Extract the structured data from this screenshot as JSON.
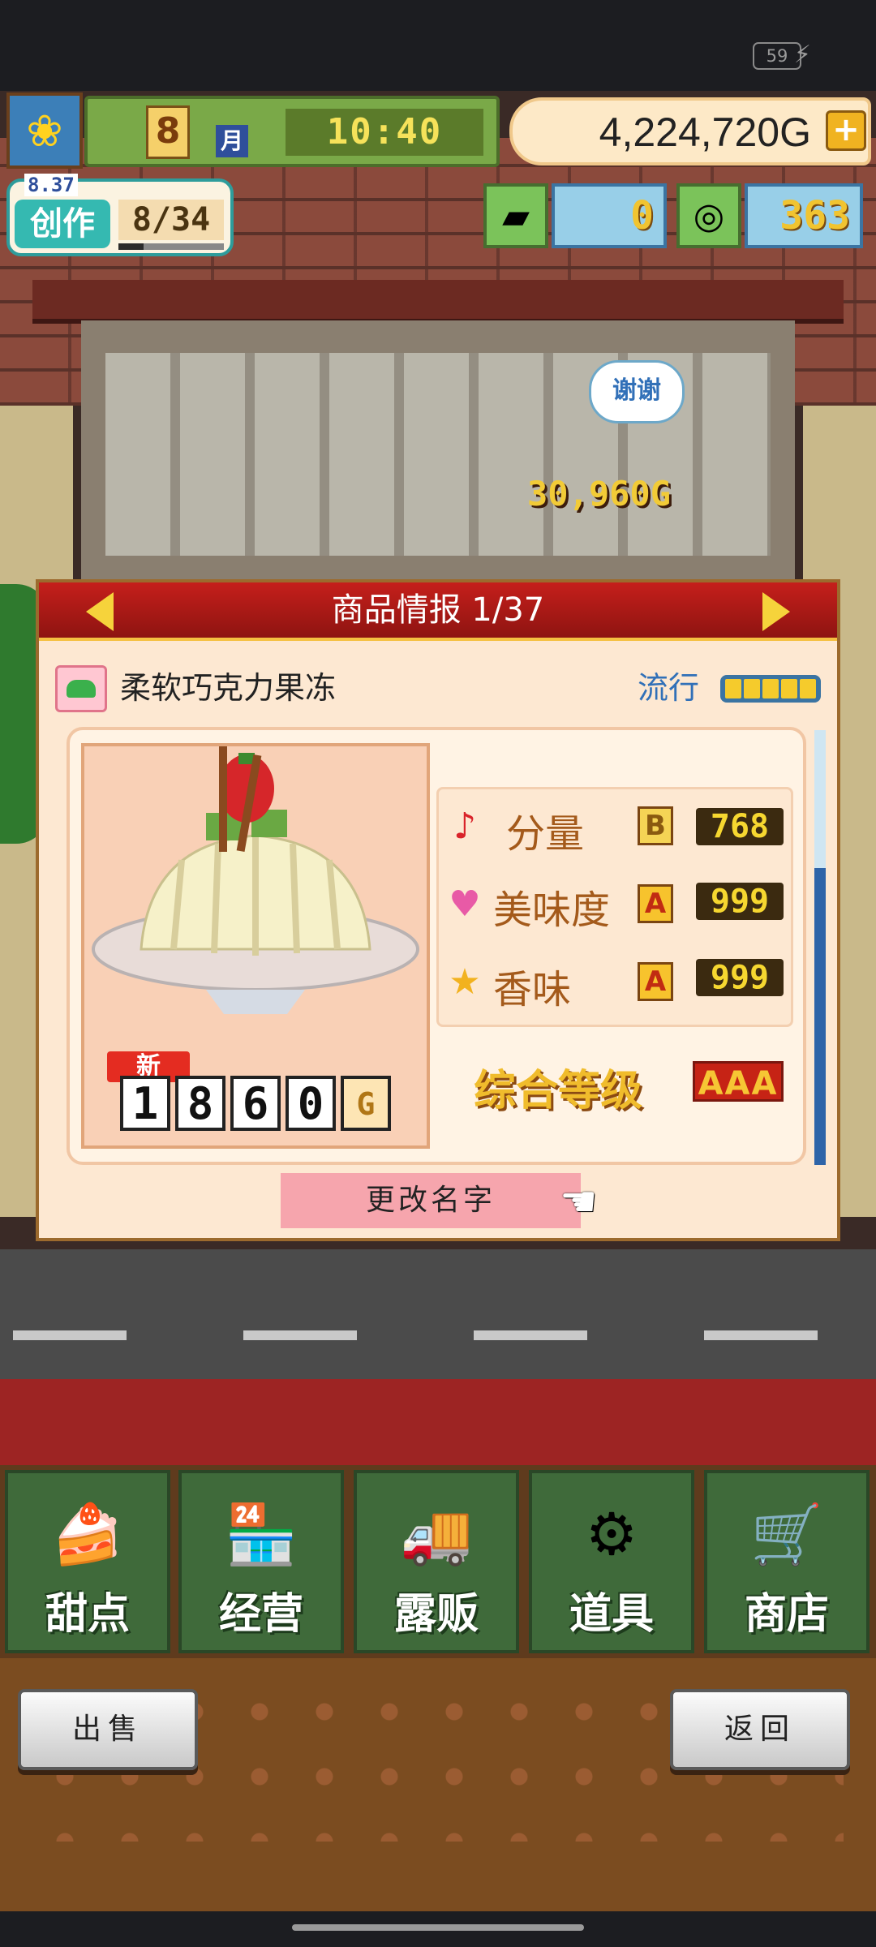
{
  "status_bar": {
    "battery": "59"
  },
  "hud": {
    "month": "8",
    "month_label": "月",
    "time": "10:40",
    "gold": "4,224,720G",
    "create_date": "8.37",
    "create_label": "创作",
    "create_progress": "8/34",
    "create_progress_ratio": 0.24,
    "ticket_count": "0",
    "medal_count": "363"
  },
  "scene": {
    "speech_bubble": "谢谢",
    "earned_popup": "30,960G"
  },
  "dialog": {
    "title": "商品情报 1/37",
    "product_name": "柔软巧克力果冻",
    "trend_label": "流行",
    "trend_level": 5,
    "trend_max": 5,
    "new_badge": "新",
    "price_digits": [
      "1",
      "8",
      "6",
      "0",
      "G"
    ],
    "stats": [
      {
        "icon": "music-note-icon",
        "label": "分量",
        "grade": "B",
        "value": "768"
      },
      {
        "icon": "heart-icon",
        "label": "美味度",
        "grade": "A",
        "value": "999"
      },
      {
        "icon": "star-icon",
        "label": "香味",
        "grade": "A",
        "value": "999"
      }
    ],
    "overall_label": "综合等级",
    "overall_grade": "AAA",
    "rename_button": "更改名字"
  },
  "nav": [
    {
      "name": "desserts",
      "label": "甜点",
      "icon": "cake-icon"
    },
    {
      "name": "management",
      "label": "经营",
      "icon": "shop-icon"
    },
    {
      "name": "street-stall",
      "label": "露贩",
      "icon": "food-truck-icon"
    },
    {
      "name": "items",
      "label": "道具",
      "icon": "item-bag-icon"
    },
    {
      "name": "store",
      "label": "商店",
      "icon": "cart-icon"
    }
  ],
  "footer": {
    "sell_button": "出售",
    "back_button": "返回"
  },
  "colors": {
    "title_red": "#c51f1b",
    "nav_green": "#3f6a3a",
    "gold_text": "#f2cb37",
    "rename_pink": "#f6a5ad"
  }
}
